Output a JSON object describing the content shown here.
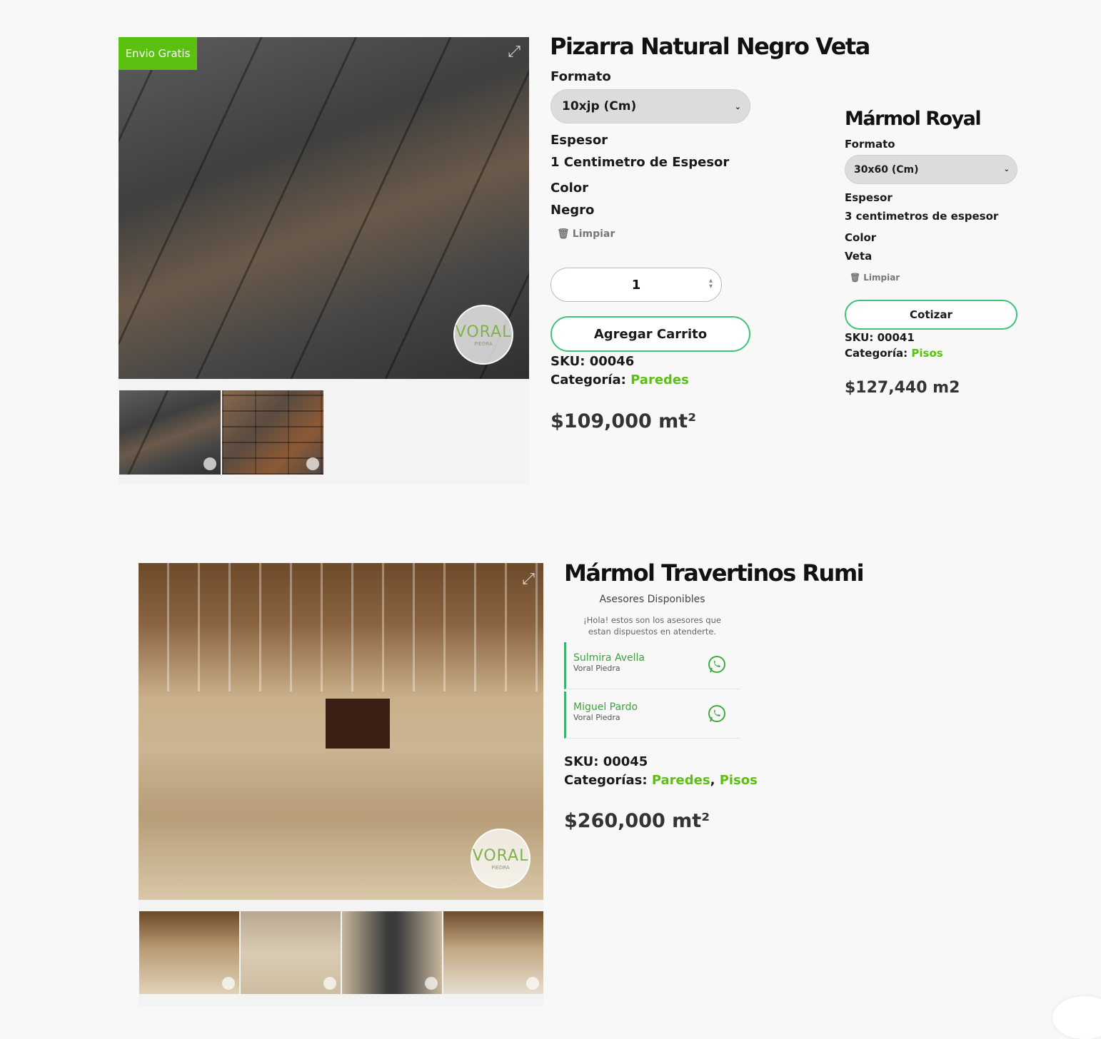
{
  "product1": {
    "badge": "Envio Gratis",
    "title": "Pizarra Natural Negro Veta",
    "formato_label": "Formato",
    "formato_value": "10xjp (Cm)",
    "espesor_label": "Espesor",
    "espesor_value": "1 Centimetro de Espesor",
    "color_label": "Color",
    "color_value": "Negro",
    "clear_label": "Limpiar",
    "quantity": "1",
    "cart_button": "Agregar Carrito",
    "sku_label": "SKU:",
    "sku_value": "00046",
    "category_label": "Categoría:",
    "category_value": "Paredes",
    "price": "$109,000 mt²"
  },
  "product2": {
    "title": "Mármol Royal",
    "formato_label": "Formato",
    "formato_value": "30x60 (Cm)",
    "espesor_label": "Espesor",
    "espesor_value": "3 centimetros de espesor",
    "color_label": "Color",
    "color_value": "Veta",
    "clear_label": "Limpiar",
    "quote_button": "Cotizar",
    "sku_label": "SKU:",
    "sku_value": "00041",
    "category_label": "Categoría:",
    "category_value": "Pisos",
    "price": "$127,440 m2"
  },
  "product3": {
    "title": "Mármol Travertinos Rumi",
    "advisors_title": "Asesores Disponibles",
    "advisors_text": "¡Hola! estos son los asesores que estan dispuestos en atenderte.",
    "advisors": [
      {
        "name": "Sulmira Avella",
        "company": "Voral Piedra"
      },
      {
        "name": "Miguel Pardo",
        "company": "Voral Piedra"
      }
    ],
    "sku_label": "SKU:",
    "sku_value": "00045",
    "category_label": "Categorías:",
    "category_1": "Paredes",
    "category_sep": ",",
    "category_2": "Pisos",
    "price": "$260,000 mt²"
  },
  "logo": {
    "name": "VORAL",
    "sub": "PIEDRA"
  },
  "colors": {
    "accent_green": "#5cc011",
    "button_border": "#3fc27a",
    "badge_bg": "#5cc011",
    "whatsapp": "#3faa3f"
  },
  "icons": {
    "expand": "expand-icon",
    "trash": "trash-icon",
    "whatsapp": "whatsapp-icon",
    "chevron": "chevron-down-icon"
  }
}
